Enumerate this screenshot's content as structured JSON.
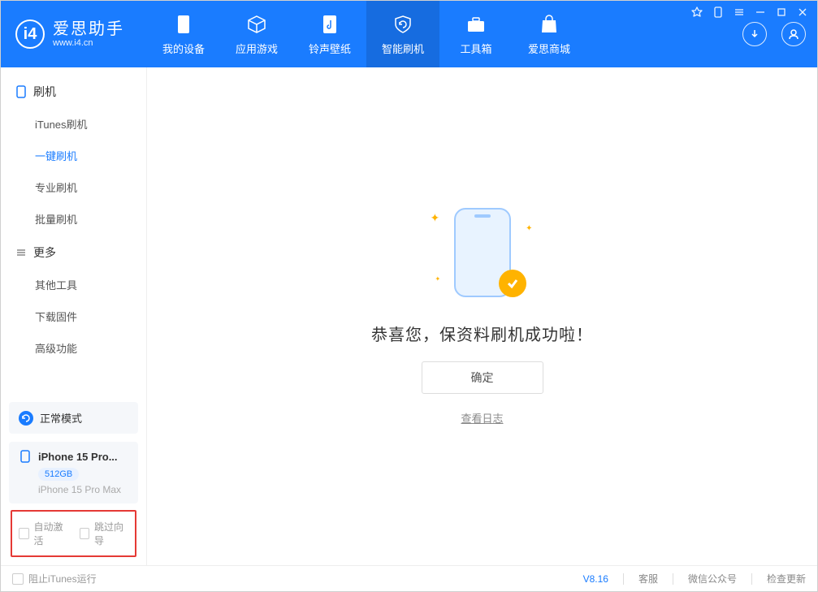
{
  "brand": {
    "title": "爱思助手",
    "sub": "www.i4.cn"
  },
  "nav": {
    "device": "我的设备",
    "apps": "应用游戏",
    "ringtone": "铃声壁纸",
    "flash": "智能刷机",
    "toolbox": "工具箱",
    "store": "爱思商城"
  },
  "sidebar": {
    "group1": {
      "header": "刷机",
      "items": [
        "iTunes刷机",
        "一键刷机",
        "专业刷机",
        "批量刷机"
      ]
    },
    "group2": {
      "header": "更多",
      "items": [
        "其他工具",
        "下载固件",
        "高级功能"
      ]
    }
  },
  "mode_card": {
    "label": "正常模式"
  },
  "device_card": {
    "name": "iPhone 15 Pro...",
    "storage": "512GB",
    "model": "iPhone 15 Pro Max"
  },
  "options": {
    "auto_activate": "自动激活",
    "skip_wizard": "跳过向导"
  },
  "main": {
    "success_title": "恭喜您，保资料刷机成功啦！",
    "confirm": "确定",
    "view_log": "查看日志"
  },
  "footer": {
    "block_itunes": "阻止iTunes运行",
    "version": "V8.16",
    "support": "客服",
    "wechat": "微信公众号",
    "check_update": "检查更新"
  }
}
